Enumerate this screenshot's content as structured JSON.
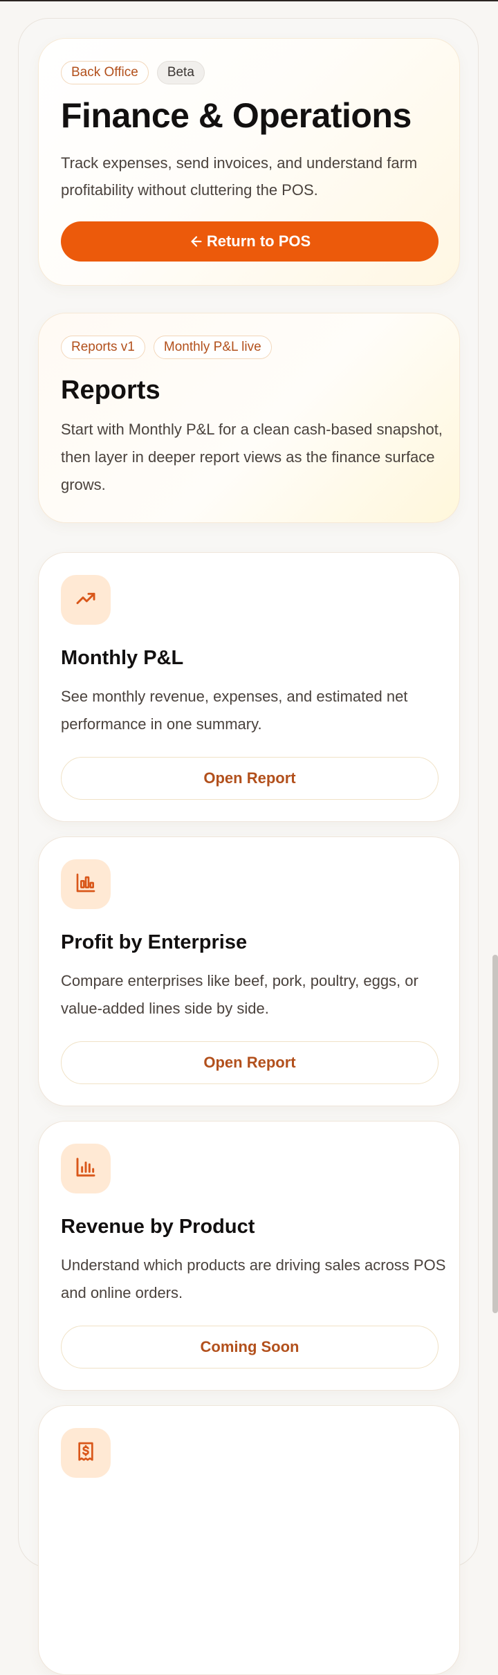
{
  "hero": {
    "badges": [
      "Back Office",
      "Beta"
    ],
    "title": "Finance & Operations",
    "description": "Track expenses, send invoices, and understand farm profitability without cluttering the POS.",
    "return_label": "Return to POS"
  },
  "reports_section": {
    "badges": [
      "Reports v1",
      "Monthly P&L live"
    ],
    "title": "Reports",
    "description": "Start with Monthly P&L for a clean cash-based snapshot, then layer in deeper report views as the finance surface grows."
  },
  "reports": [
    {
      "icon": "trending-up-icon",
      "title": "Monthly P&L",
      "description": "See monthly revenue, expenses, and estimated net performance in one summary.",
      "action_label": "Open Report"
    },
    {
      "icon": "bar-chart-icon",
      "title": "Profit by Enterprise",
      "description": "Compare enterprises like beef, pork, poultry, eggs, or value-added lines side by side.",
      "action_label": "Open Report"
    },
    {
      "icon": "column-chart-icon",
      "title": "Revenue by Product",
      "description": "Understand which products are driving sales across POS and online orders.",
      "action_label": "Coming Soon"
    },
    {
      "icon": "receipt-dollar-icon"
    }
  ],
  "colors": {
    "accent": "#ec5a0b",
    "accent_text": "#b2501c",
    "icon_tile": "#ffe9d4"
  }
}
